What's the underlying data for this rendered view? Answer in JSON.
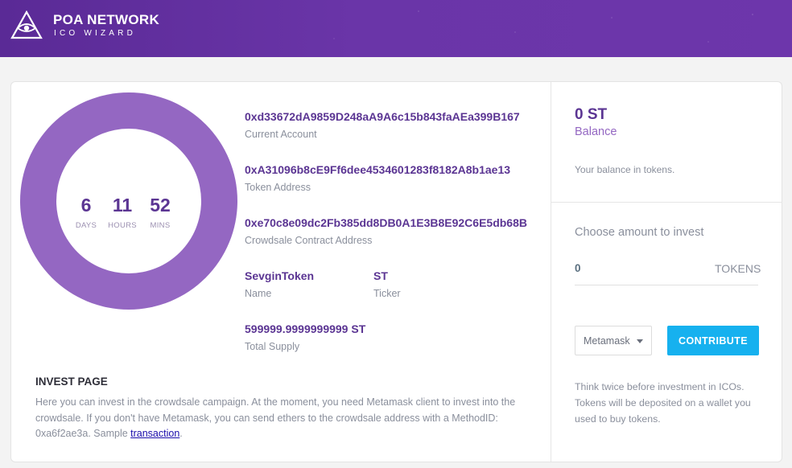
{
  "header": {
    "title": "POA NETWORK",
    "subtitle": "ICO WIZARD"
  },
  "countdown": {
    "days": "6",
    "days_label": "DAYS",
    "hours": "11",
    "hours_label": "HOURS",
    "mins": "52",
    "mins_label": "MINS"
  },
  "info": {
    "current_account": "0xd33672dA9859D248aA9A6c15b843faAEa399B167",
    "current_account_label": "Current Account",
    "token_address": "0xA31096b8cE9Ff6dee4534601283f8182A8b1ae13",
    "token_address_label": "Token Address",
    "crowdsale_address": "0xe70c8e09dc2Fb385dd8DB0A1E3B8E92C6E5db68B",
    "crowdsale_address_label": "Crowdsale Contract Address",
    "name": "SevginToken",
    "name_label": "Name",
    "ticker": "ST",
    "ticker_label": "Ticker",
    "total_supply": "599999.9999999999 ST",
    "total_supply_label": "Total Supply"
  },
  "invest": {
    "title": "INVEST PAGE",
    "text": "Here you can invest in the crowdsale campaign. At the moment, you need Metamask client to invest into the crowdsale. If you don't have Metamask, you can send ethers to the crowdsale address with a MethodID: 0xa6f2ae3a. Sample ",
    "link_text": "transaction",
    "text_end": "."
  },
  "balance": {
    "value": "0 ST",
    "label": "Balance",
    "note": "Your balance in tokens."
  },
  "contribute": {
    "choose_label": "Choose amount to invest",
    "amount": "0",
    "unit": "TOKENS",
    "wallet_selected": "Metamask",
    "button_label": "CONTRIBUTE",
    "warning": "Think twice before investment in ICOs. Tokens will be deposited on a wallet you used to buy tokens."
  },
  "colors": {
    "header": "#6a35a8",
    "donut": "#9467c2",
    "accent_text": "#5b3593",
    "button": "#16b1ef"
  }
}
